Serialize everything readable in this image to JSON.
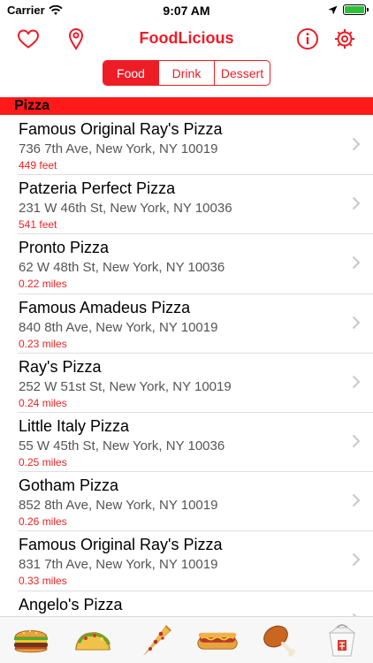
{
  "status": {
    "carrier": "Carrier",
    "time": "9:07 AM"
  },
  "header": {
    "title": "FoodLicious"
  },
  "segments": [
    {
      "label": "Food",
      "active": true
    },
    {
      "label": "Drink",
      "active": false
    },
    {
      "label": "Dessert",
      "active": false
    }
  ],
  "section": {
    "title": "Pizza"
  },
  "places": [
    {
      "name": "Famous Original Ray's Pizza",
      "address": "736 7th Ave, New York, NY 10019",
      "distance": "449 feet"
    },
    {
      "name": "Patzeria Perfect Pizza",
      "address": "231 W 46th St, New York, NY 10036",
      "distance": "541 feet"
    },
    {
      "name": "Pronto Pizza",
      "address": "62 W 48th St, New York, NY 10036",
      "distance": "0.22 miles"
    },
    {
      "name": "Famous Amadeus Pizza",
      "address": "840 8th Ave, New York, NY 10019",
      "distance": "0.23 miles"
    },
    {
      "name": "Ray's Pizza",
      "address": "252 W 51st St, New York, NY 10019",
      "distance": "0.24 miles"
    },
    {
      "name": "Little Italy Pizza",
      "address": "55 W 45th St, New York, NY 10036",
      "distance": "0.25 miles"
    },
    {
      "name": "Gotham Pizza",
      "address": "852 8th Ave, New York, NY 10019",
      "distance": "0.26 miles"
    },
    {
      "name": "Famous Original Ray's Pizza",
      "address": "831 7th Ave, New York, NY 10019",
      "distance": "0.33 miles"
    },
    {
      "name": "Angelo's Pizza",
      "address": "",
      "distance": ""
    }
  ],
  "tabs": [
    {
      "icon": "burger-icon"
    },
    {
      "icon": "taco-icon"
    },
    {
      "icon": "pizza-slice-icon"
    },
    {
      "icon": "hotdog-icon"
    },
    {
      "icon": "chicken-leg-icon"
    },
    {
      "icon": "takeout-box-icon"
    }
  ],
  "colors": {
    "accent": "#ee1c25",
    "section": "#ff1a1a",
    "distance": "#e22222"
  }
}
